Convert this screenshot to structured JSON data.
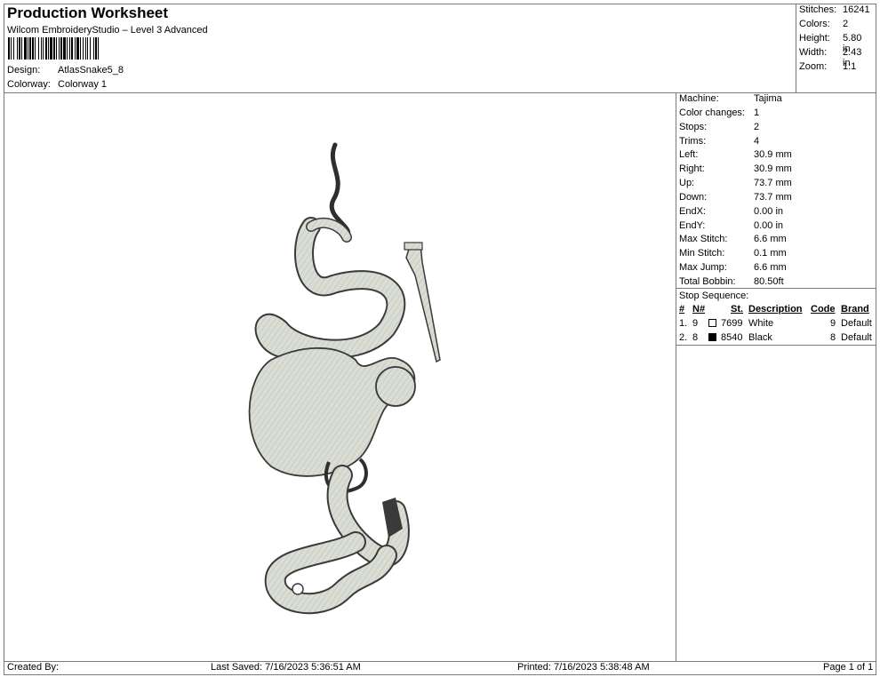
{
  "header": {
    "title": "Production Worksheet",
    "software": "Wilcom EmbroideryStudio – Level 3 Advanced",
    "design_label": "Design:",
    "design_value": "AtlasSnake5_8",
    "colorway_label": "Colorway:",
    "colorway_value": "Colorway 1"
  },
  "summary": {
    "stitches_label": "Stitches:",
    "stitches_value": "16241",
    "colors_label": "Colors:",
    "colors_value": "2",
    "height_label": "Height:",
    "height_value": "5.80 in",
    "width_label": "Width:",
    "width_value": "2.43 in",
    "zoom_label": "Zoom:",
    "zoom_value": "1:1"
  },
  "machine": {
    "rows": [
      {
        "label": "Machine:",
        "value": "Tajima"
      },
      {
        "label": "Color changes:",
        "value": "1"
      },
      {
        "label": "Stops:",
        "value": "2"
      },
      {
        "label": "Trims:",
        "value": "4"
      },
      {
        "label": "Left:",
        "value": "30.9 mm"
      },
      {
        "label": "Right:",
        "value": "30.9 mm"
      },
      {
        "label": "Up:",
        "value": "73.7 mm"
      },
      {
        "label": "Down:",
        "value": "73.7 mm"
      },
      {
        "label": "EndX:",
        "value": "0.00 in"
      },
      {
        "label": "EndY:",
        "value": "0.00 in"
      },
      {
        "label": "Max Stitch:",
        "value": "6.6 mm"
      },
      {
        "label": "Min Stitch:",
        "value": "0.1 mm"
      },
      {
        "label": "Max Jump:",
        "value": "6.6 mm"
      },
      {
        "label": "Total Bobbin:",
        "value": "80.50ft"
      }
    ]
  },
  "stop_sequence": {
    "title": "Stop Sequence:",
    "headers": {
      "num": "#",
      "n": "N#",
      "st": "St.",
      "description": "Description",
      "code": "Code",
      "brand": "Brand"
    },
    "rows": [
      {
        "num": "1.",
        "n": "9",
        "swatch_color": "#ffffff",
        "st": "7699",
        "description": "White",
        "code": "9",
        "brand": "Default"
      },
      {
        "num": "2.",
        "n": "8",
        "swatch_color": "#000000",
        "st": "8540",
        "description": "Black",
        "code": "8",
        "brand": "Default"
      }
    ]
  },
  "footer": {
    "created_by": "Created By:",
    "last_saved": "Last Saved: 7/16/2023 5:36:51 AM",
    "printed": "Printed: 7/16/2023 5:38:48 AM",
    "page": "Page 1 of 1"
  },
  "colors": {
    "thread_fill": "#d9ddd3",
    "thread_outline": "#3a3a3a",
    "border": "#7a7a7a"
  }
}
